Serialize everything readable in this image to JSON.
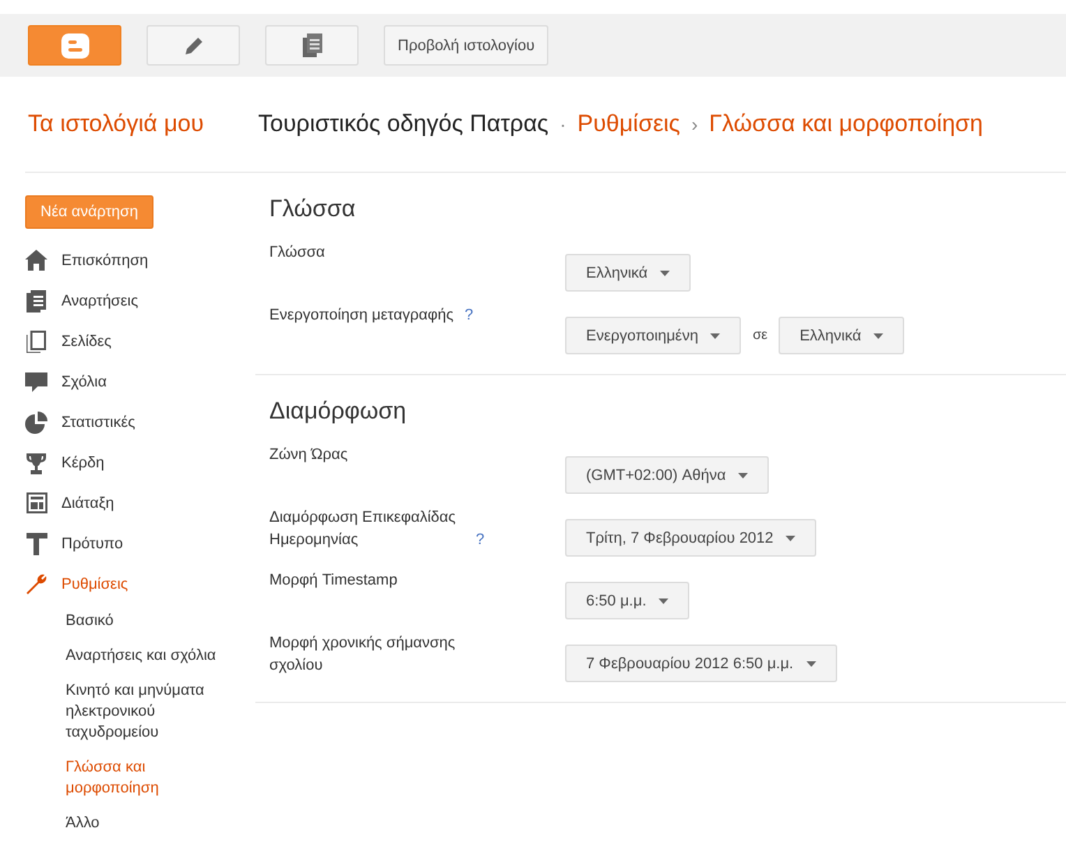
{
  "toolbar": {
    "view_blog_button": "Προβολή ιστολογίου"
  },
  "header": {
    "my_blogs_link": "Τα ιστολόγιά μου",
    "breadcrumb": [
      {
        "kind": "title",
        "text": "Τουριστικός οδηγός Πατρας"
      },
      {
        "kind": "separator",
        "text": "·"
      },
      {
        "kind": "link",
        "text": "Ρυθμίσεις"
      },
      {
        "kind": "separator",
        "text": "›"
      },
      {
        "kind": "link",
        "text": "Γλώσσα και μορφοποίηση"
      }
    ]
  },
  "sidebar": {
    "new_post_button": "Νέα ανάρτηση",
    "items": [
      {
        "label": "Επισκόπηση",
        "kind": "home",
        "selected": false
      },
      {
        "label": "Αναρτήσεις",
        "kind": "posts",
        "selected": false
      },
      {
        "label": "Σελίδες",
        "kind": "pages",
        "selected": false
      },
      {
        "label": "Σχόλια",
        "kind": "comments",
        "selected": false
      },
      {
        "label": "Στατιστικές",
        "kind": "stats",
        "selected": false
      },
      {
        "label": "Κέρδη",
        "kind": "earnings",
        "selected": false
      },
      {
        "label": "Διάταξη",
        "kind": "layout",
        "selected": false
      },
      {
        "label": "Πρότυπο",
        "kind": "template",
        "selected": false
      },
      {
        "label": "Ρυθμίσεις",
        "kind": "settings",
        "selected": true,
        "children": [
          {
            "label": "Βασικό",
            "selected": false
          },
          {
            "label": "Αναρτήσεις και σχόλια",
            "selected": false
          },
          {
            "label": "Κινητό και μηνύματα ηλεκτρονικού ταχυδρομείου",
            "selected": false
          },
          {
            "label": "Γλώσσα και μορφοποίηση",
            "selected": true
          },
          {
            "label": "Άλλο",
            "selected": false
          }
        ]
      }
    ]
  },
  "sections": [
    {
      "title": "Γλώσσα",
      "rows": [
        {
          "label": "Γλώσσα",
          "controls": [
            {
              "kind": "dropdown",
              "value": "Ελληνικά"
            }
          ]
        },
        {
          "label": "Ενεργοποίηση μεταγραφής",
          "help": "?",
          "controls": [
            {
              "kind": "dropdown",
              "value": "Ενεργοποιημένη"
            },
            {
              "kind": "text",
              "value": "σε"
            },
            {
              "kind": "dropdown",
              "value": "Ελληνικά"
            }
          ]
        }
      ]
    },
    {
      "title": "Διαμόρφωση",
      "rows": [
        {
          "label": "Ζώνη Ώρας",
          "controls": [
            {
              "kind": "dropdown",
              "value": "(GMT+02:00) Αθήνα"
            }
          ]
        },
        {
          "label": "Διαμόρφωση Επικεφαλίδας Ημερομηνίας",
          "help": "?",
          "controls": [
            {
              "kind": "dropdown",
              "value": "Τρίτη, 7 Φεβρουαρίου 2012"
            }
          ]
        },
        {
          "label": "Μορφή Timestamp",
          "controls": [
            {
              "kind": "dropdown",
              "value": "6:50 μ.μ."
            }
          ]
        },
        {
          "label": "Μορφή χρονικής σήμανσης σχολίου",
          "controls": [
            {
              "kind": "dropdown",
              "value": "7 Φεβρουαρίου 2012 6:50 μ.μ."
            }
          ]
        }
      ]
    }
  ]
}
